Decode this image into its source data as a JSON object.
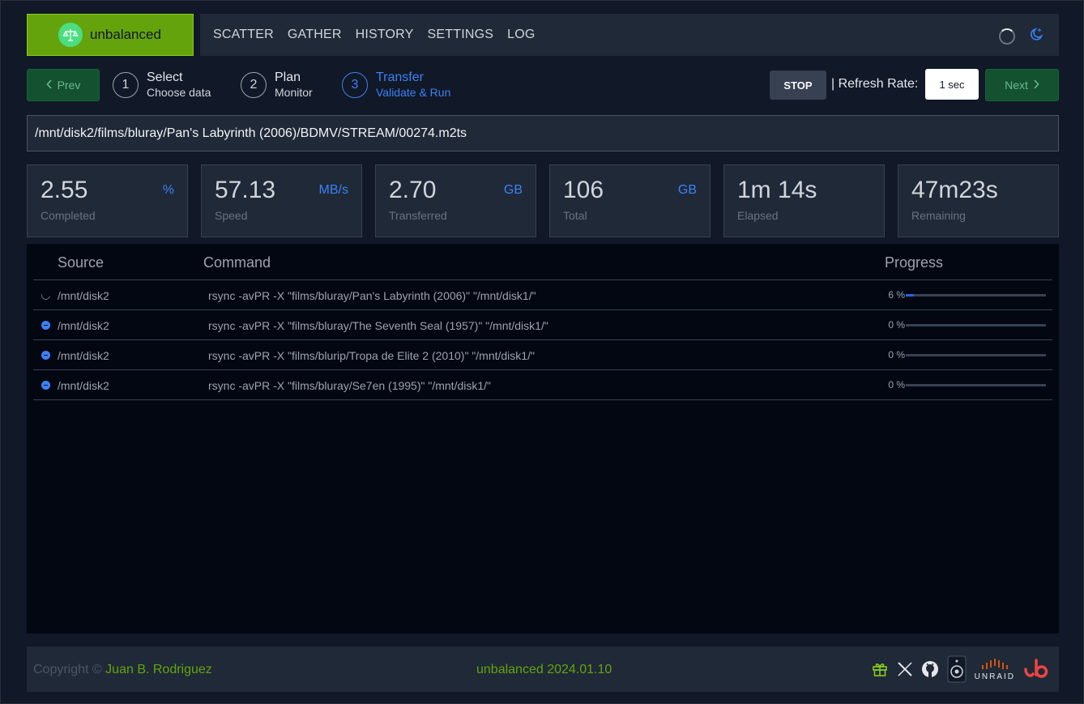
{
  "app": {
    "name": "unbalanced"
  },
  "nav": {
    "items": [
      "SCATTER",
      "GATHER",
      "HISTORY",
      "SETTINGS",
      "LOG"
    ]
  },
  "steps": {
    "prev_label": "Prev",
    "next_label": "Next",
    "items": [
      {
        "num": "1",
        "title": "Select",
        "sub": "Choose data"
      },
      {
        "num": "2",
        "title": "Plan",
        "sub": "Monitor"
      },
      {
        "num": "3",
        "title": "Transfer",
        "sub": "Validate & Run"
      }
    ],
    "active_step": 3
  },
  "controls": {
    "stop_label": "STOP",
    "refresh_label": "| Refresh Rate:",
    "refresh_value": "1 sec"
  },
  "current_file": "/mnt/disk2/films/bluray/Pan's Labyrinth (2006)/BDMV/STREAM/00274.m2ts",
  "stats": [
    {
      "value": "2.55",
      "unit": "%",
      "label": "Completed"
    },
    {
      "value": "57.13",
      "unit": "MB/s",
      "label": "Speed"
    },
    {
      "value": "2.70",
      "unit": "GB",
      "label": "Transferred"
    },
    {
      "value": "106",
      "unit": "GB",
      "label": "Total"
    },
    {
      "value": "1m 14s",
      "unit": "",
      "label": "Elapsed"
    },
    {
      "value": "47m23s",
      "unit": "",
      "label": "Remaining"
    }
  ],
  "table": {
    "headers": {
      "source": "Source",
      "command": "Command",
      "progress": "Progress"
    },
    "rows": [
      {
        "status": "running",
        "source": "/mnt/disk2",
        "command": "rsync -avPR -X \"films/bluray/Pan's Labyrinth (2006)\" \"/mnt/disk1/\"",
        "progress_text": "6 %",
        "progress": 0.06
      },
      {
        "status": "pending",
        "source": "/mnt/disk2",
        "command": "rsync -avPR -X \"films/bluray/The Seventh Seal (1957)\" \"/mnt/disk1/\"",
        "progress_text": "0 %",
        "progress": 0.0
      },
      {
        "status": "pending",
        "source": "/mnt/disk2",
        "command": "rsync -avPR -X \"films/blurip/Tropa de Elite 2 (2010)\" \"/mnt/disk1/\"",
        "progress_text": "0 %",
        "progress": 0.0
      },
      {
        "status": "pending",
        "source": "/mnt/disk2",
        "command": "rsync -avPR -X \"films/bluray/Se7en (1995)\" \"/mnt/disk1/\"",
        "progress_text": "0 %",
        "progress": 0.0
      }
    ]
  },
  "footer": {
    "copyright_prefix": "Copyright ©",
    "author": "Juan B. Rodriguez",
    "version": "unbalanced 2024.01.10",
    "unraid_text": "UNRAID",
    "icons": [
      "gift-icon",
      "x-icon",
      "github-icon",
      "speaker-icon",
      "unraid-logo",
      "unbalanced-logo"
    ]
  },
  "colors": {
    "brand": "#65a30d",
    "accent": "#3b82f6",
    "background": "#111827"
  }
}
